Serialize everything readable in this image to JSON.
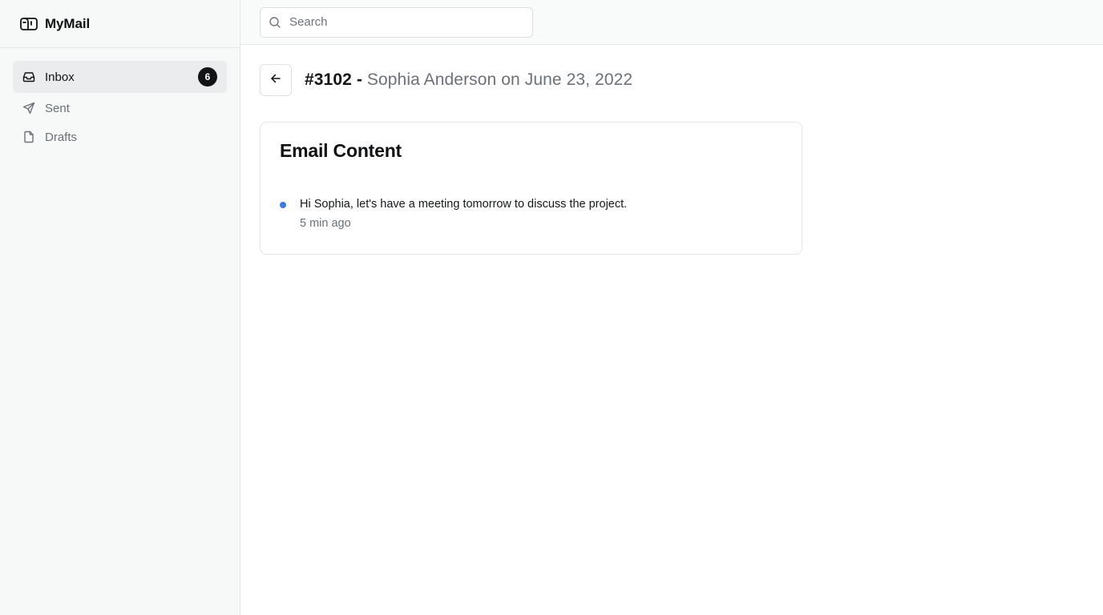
{
  "app": {
    "name": "MyMail",
    "logo_icon": "mailbox-icon"
  },
  "sidebar": {
    "items": [
      {
        "label": "Inbox",
        "icon": "inbox-icon",
        "badge": "6",
        "active": true
      },
      {
        "label": "Sent",
        "icon": "send-icon",
        "active": false
      },
      {
        "label": "Drafts",
        "icon": "file-icon",
        "active": false
      }
    ]
  },
  "search": {
    "placeholder": "Search",
    "value": ""
  },
  "email": {
    "id": "#3102 -",
    "meta": "Sophia Anderson on June 23, 2022"
  },
  "card": {
    "title": "Email Content",
    "message": "Hi Sophia, let's have a meeting tomorrow to discuss the project.",
    "time": "5 min ago"
  },
  "colors": {
    "accent_dot": "#3d7be0",
    "badge_bg": "#121416",
    "sidebar_bg": "#f7f8f8"
  }
}
